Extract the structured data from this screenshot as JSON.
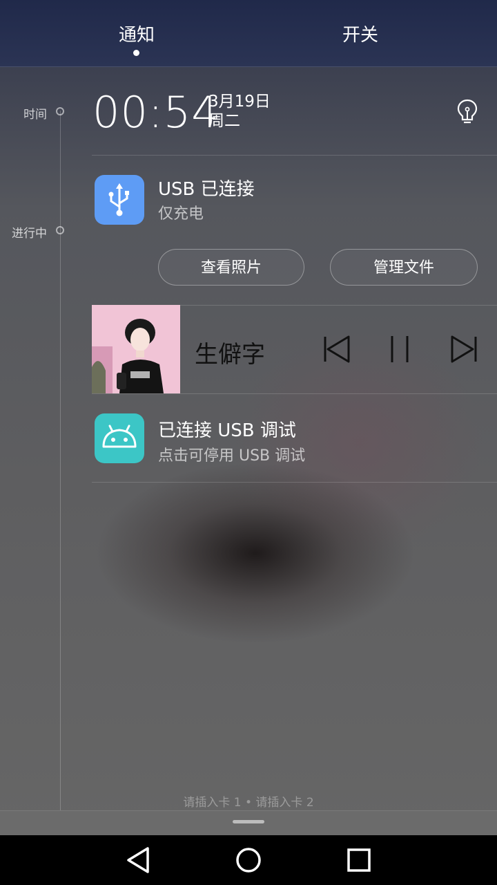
{
  "tabs": {
    "notifications": "通知",
    "switches": "开关"
  },
  "timeline": {
    "time_label": "时间",
    "ongoing_label": "进行中"
  },
  "clock": {
    "time": "00:54",
    "date": "3月19日",
    "weekday": "周二"
  },
  "usb_notification": {
    "title": "USB 已连接",
    "subtitle": "仅充电",
    "actions": [
      "查看照片",
      "管理文件"
    ],
    "icon": "usb-icon",
    "color": "#5e9cf5"
  },
  "media": {
    "song_title": "生僻字",
    "controls": [
      "previous-icon",
      "pause-icon",
      "next-icon"
    ]
  },
  "debug_notification": {
    "title": "已连接 USB 调试",
    "subtitle": "点击可停用 USB 调试",
    "icon": "android-icon",
    "color": "#3cc6c6"
  },
  "sim_status": "请插入卡 1 • 请插入卡 2",
  "navbar": [
    "back-icon",
    "home-icon",
    "recents-icon"
  ]
}
